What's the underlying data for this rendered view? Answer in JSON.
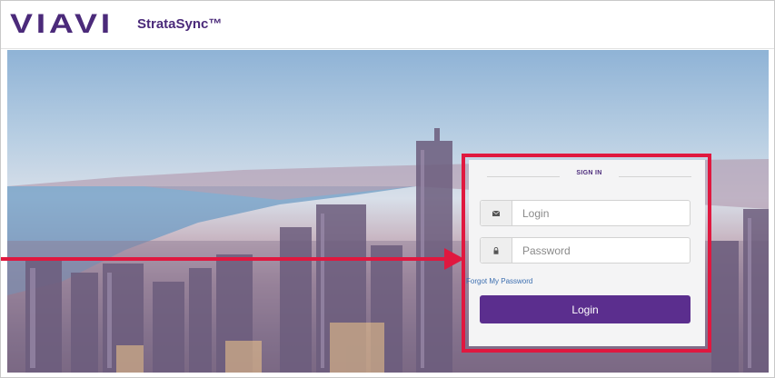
{
  "header": {
    "logo_text": "VIAVI",
    "app_name": "StrataSync™"
  },
  "signin": {
    "title": "SIGN IN",
    "login_placeholder": "Login",
    "password_placeholder": "Password",
    "forgot_label": "Forgot My Password",
    "login_button_label": "Login"
  },
  "icons": {
    "login_field": "envelope-icon",
    "password_field": "lock-icon"
  },
  "colors": {
    "brand_purple": "#5b2e8e",
    "highlight_red": "#e0183f",
    "link_blue": "#3d6fb0"
  }
}
